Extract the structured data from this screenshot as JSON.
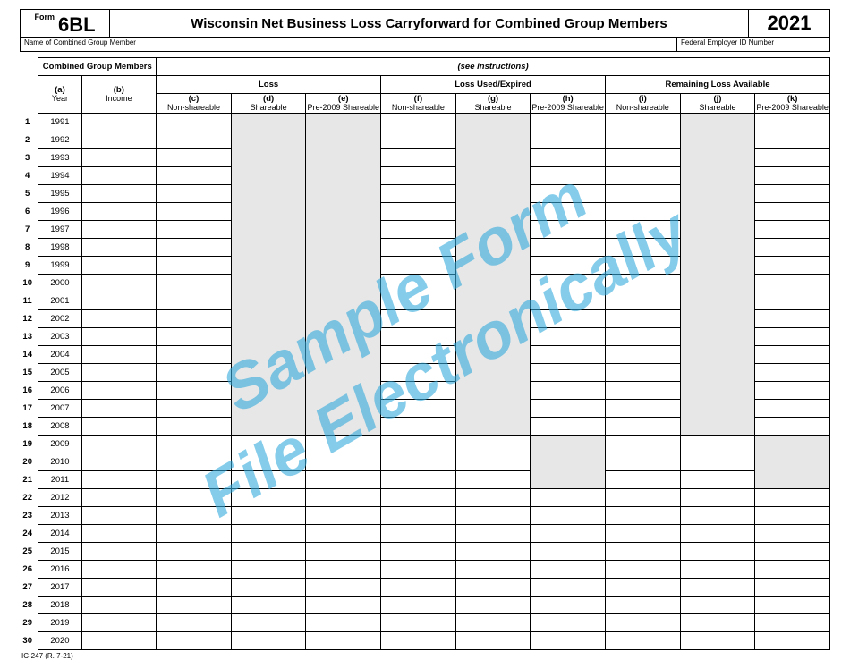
{
  "header": {
    "form_label": "Form",
    "form_number": "6BL",
    "title": "Wisconsin Net Business Loss Carryforward for Combined Group Members",
    "year": "2021"
  },
  "ident": {
    "name_label": "Name of Combined Group Member",
    "fein_label": "Federal Employer ID Number",
    "name_value": "",
    "fein_value": ""
  },
  "table": {
    "cgm_header": "Combined Group Members",
    "see_instructions": "(see instructions)",
    "group_loss": "Loss",
    "group_used": "Loss Used/Expired",
    "group_remain": "Remaining Loss Available",
    "cols": {
      "a": {
        "let": "(a)",
        "lbl": "Year"
      },
      "b": {
        "let": "(b)",
        "lbl": "Income"
      },
      "c": {
        "let": "(c)",
        "lbl": "Non-shareable"
      },
      "d": {
        "let": "(d)",
        "lbl": "Shareable"
      },
      "e": {
        "let": "(e)",
        "lbl": "Pre-2009 Shareable"
      },
      "f": {
        "let": "(f)",
        "lbl": "Non-shareable"
      },
      "g": {
        "let": "(g)",
        "lbl": "Shareable"
      },
      "h": {
        "let": "(h)",
        "lbl": "Pre-2009 Shareable"
      },
      "i": {
        "let": "(i)",
        "lbl": "Non-shareable"
      },
      "j": {
        "let": "(j)",
        "lbl": "Shareable"
      },
      "k": {
        "let": "(k)",
        "lbl": "Pre-2009 Shareable"
      }
    },
    "rows": [
      {
        "n": "1",
        "year": "1991",
        "b": "",
        "c": "",
        "d": "",
        "e": "",
        "f": "",
        "g": "",
        "h": "",
        "i": "",
        "j": "",
        "k": ""
      },
      {
        "n": "2",
        "year": "1992",
        "b": "",
        "c": "",
        "d": "",
        "e": "",
        "f": "",
        "g": "",
        "h": "",
        "i": "",
        "j": "",
        "k": ""
      },
      {
        "n": "3",
        "year": "1993",
        "b": "",
        "c": "",
        "d": "",
        "e": "",
        "f": "",
        "g": "",
        "h": "",
        "i": "",
        "j": "",
        "k": ""
      },
      {
        "n": "4",
        "year": "1994",
        "b": "",
        "c": "",
        "d": "",
        "e": "",
        "f": "",
        "g": "",
        "h": "",
        "i": "",
        "j": "",
        "k": ""
      },
      {
        "n": "5",
        "year": "1995",
        "b": "",
        "c": "",
        "d": "",
        "e": "",
        "f": "",
        "g": "",
        "h": "",
        "i": "",
        "j": "",
        "k": ""
      },
      {
        "n": "6",
        "year": "1996",
        "b": "",
        "c": "",
        "d": "",
        "e": "",
        "f": "",
        "g": "",
        "h": "",
        "i": "",
        "j": "",
        "k": ""
      },
      {
        "n": "7",
        "year": "1997",
        "b": "",
        "c": "",
        "d": "",
        "e": "",
        "f": "",
        "g": "",
        "h": "",
        "i": "",
        "j": "",
        "k": ""
      },
      {
        "n": "8",
        "year": "1998",
        "b": "",
        "c": "",
        "d": "",
        "e": "",
        "f": "",
        "g": "",
        "h": "",
        "i": "",
        "j": "",
        "k": ""
      },
      {
        "n": "9",
        "year": "1999",
        "b": "",
        "c": "",
        "d": "",
        "e": "",
        "f": "",
        "g": "",
        "h": "",
        "i": "",
        "j": "",
        "k": ""
      },
      {
        "n": "10",
        "year": "2000",
        "b": "",
        "c": "",
        "d": "",
        "e": "",
        "f": "",
        "g": "",
        "h": "",
        "i": "",
        "j": "",
        "k": ""
      },
      {
        "n": "11",
        "year": "2001",
        "b": "",
        "c": "",
        "d": "",
        "e": "",
        "f": "",
        "g": "",
        "h": "",
        "i": "",
        "j": "",
        "k": ""
      },
      {
        "n": "12",
        "year": "2002",
        "b": "",
        "c": "",
        "d": "",
        "e": "",
        "f": "",
        "g": "",
        "h": "",
        "i": "",
        "j": "",
        "k": ""
      },
      {
        "n": "13",
        "year": "2003",
        "b": "",
        "c": "",
        "d": "",
        "e": "",
        "f": "",
        "g": "",
        "h": "",
        "i": "",
        "j": "",
        "k": ""
      },
      {
        "n": "14",
        "year": "2004",
        "b": "",
        "c": "",
        "d": "",
        "e": "",
        "f": "",
        "g": "",
        "h": "",
        "i": "",
        "j": "",
        "k": ""
      },
      {
        "n": "15",
        "year": "2005",
        "b": "",
        "c": "",
        "d": "",
        "e": "",
        "f": "",
        "g": "",
        "h": "",
        "i": "",
        "j": "",
        "k": ""
      },
      {
        "n": "16",
        "year": "2006",
        "b": "",
        "c": "",
        "d": "",
        "e": "",
        "f": "",
        "g": "",
        "h": "",
        "i": "",
        "j": "",
        "k": ""
      },
      {
        "n": "17",
        "year": "2007",
        "b": "",
        "c": "",
        "d": "",
        "e": "",
        "f": "",
        "g": "",
        "h": "",
        "i": "",
        "j": "",
        "k": ""
      },
      {
        "n": "18",
        "year": "2008",
        "b": "",
        "c": "",
        "d": "",
        "e": "",
        "f": "",
        "g": "",
        "h": "",
        "i": "",
        "j": "",
        "k": ""
      },
      {
        "n": "19",
        "year": "2009",
        "b": "",
        "c": "",
        "d": "",
        "e": "",
        "f": "",
        "g": "",
        "h": "",
        "i": "",
        "j": "",
        "k": ""
      },
      {
        "n": "20",
        "year": "2010",
        "b": "",
        "c": "",
        "d": "",
        "e": "",
        "f": "",
        "g": "",
        "h": "",
        "i": "",
        "j": "",
        "k": ""
      },
      {
        "n": "21",
        "year": "2011",
        "b": "",
        "c": "",
        "d": "",
        "e": "",
        "f": "",
        "g": "",
        "h": "",
        "i": "",
        "j": "",
        "k": ""
      },
      {
        "n": "22",
        "year": "2012",
        "b": "",
        "c": "",
        "d": "",
        "e": "",
        "f": "",
        "g": "",
        "h": "",
        "i": "",
        "j": "",
        "k": ""
      },
      {
        "n": "23",
        "year": "2013",
        "b": "",
        "c": "",
        "d": "",
        "e": "",
        "f": "",
        "g": "",
        "h": "",
        "i": "",
        "j": "",
        "k": ""
      },
      {
        "n": "24",
        "year": "2014",
        "b": "",
        "c": "",
        "d": "",
        "e": "",
        "f": "",
        "g": "",
        "h": "",
        "i": "",
        "j": "",
        "k": ""
      },
      {
        "n": "25",
        "year": "2015",
        "b": "",
        "c": "",
        "d": "",
        "e": "",
        "f": "",
        "g": "",
        "h": "",
        "i": "",
        "j": "",
        "k": ""
      },
      {
        "n": "26",
        "year": "2016",
        "b": "",
        "c": "",
        "d": "",
        "e": "",
        "f": "",
        "g": "",
        "h": "",
        "i": "",
        "j": "",
        "k": ""
      },
      {
        "n": "27",
        "year": "2017",
        "b": "",
        "c": "",
        "d": "",
        "e": "",
        "f": "",
        "g": "",
        "h": "",
        "i": "",
        "j": "",
        "k": ""
      },
      {
        "n": "28",
        "year": "2018",
        "b": "",
        "c": "",
        "d": "",
        "e": "",
        "f": "",
        "g": "",
        "h": "",
        "i": "",
        "j": "",
        "k": ""
      },
      {
        "n": "29",
        "year": "2019",
        "b": "",
        "c": "",
        "d": "",
        "e": "",
        "f": "",
        "g": "",
        "h": "",
        "i": "",
        "j": "",
        "k": ""
      },
      {
        "n": "30",
        "year": "2020",
        "b": "",
        "c": "",
        "d": "",
        "e": "",
        "f": "",
        "g": "",
        "h": "",
        "i": "",
        "j": "",
        "k": ""
      }
    ]
  },
  "watermark": {
    "line1": "Sample Form",
    "line2": "File Electronically"
  },
  "footer": {
    "code": "IC-247 (R. 7-21)"
  }
}
